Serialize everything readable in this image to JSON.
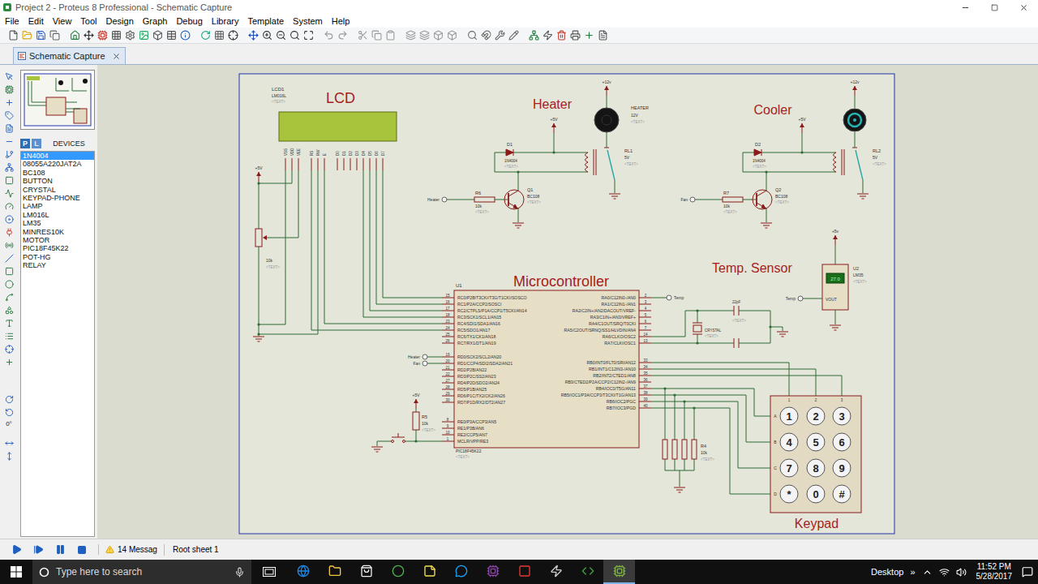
{
  "window": {
    "title": "Project 2 - Proteus 8 Professional - Schematic Capture"
  },
  "menu": [
    "File",
    "Edit",
    "View",
    "Tool",
    "Design",
    "Graph",
    "Debug",
    "Library",
    "Template",
    "System",
    "Help"
  ],
  "tabs": [
    {
      "label": "Schematic Capture",
      "selected": true
    }
  ],
  "rotation": "0°",
  "picker": {
    "modes": [
      {
        "label": "P",
        "selected": true
      },
      {
        "label": "L",
        "selected": false
      }
    ],
    "title": "DEVICES",
    "devices": [
      {
        "label": "1N4004",
        "selected": true
      },
      {
        "label": "08055A220JAT2A",
        "selected": false
      },
      {
        "label": "BC108",
        "selected": false
      },
      {
        "label": "BUTTON",
        "selected": false
      },
      {
        "label": "CRYSTAL",
        "selected": false
      },
      {
        "label": "KEYPAD-PHONE",
        "selected": false
      },
      {
        "label": "LAMP",
        "selected": false
      },
      {
        "label": "LM016L",
        "selected": false
      },
      {
        "label": "LM35",
        "selected": false
      },
      {
        "label": "MINRES10K",
        "selected": false
      },
      {
        "label": "MOTOR",
        "selected": false
      },
      {
        "label": "PIC18F45K22",
        "selected": false
      },
      {
        "label": "POT-HG",
        "selected": false
      },
      {
        "label": "RELAY",
        "selected": false
      }
    ]
  },
  "schematic": {
    "lcd": {
      "ref": "LCD1",
      "part": "LM016L",
      "text": "<TEXT>",
      "title": "LCD",
      "pins": [
        "VSS",
        "VDD",
        "VEE",
        "RS",
        "RW",
        "E",
        "D0",
        "D1",
        "D2",
        "D3",
        "D4",
        "D5",
        "D6",
        "D7"
      ]
    },
    "contrast_pot": {
      "supply": "+5V",
      "value": "10k",
      "text": "<TEXT>"
    },
    "drivers": [
      {
        "title": "Heater",
        "net": "Heater",
        "load": {
          "kind": "lamp",
          "name": "HEATER",
          "rating": "12V",
          "text": "<TEXT>",
          "supply": "+12v"
        },
        "diode": {
          "ref": "D1",
          "part": "1N4004",
          "text": "<TEXT>"
        },
        "relay": {
          "ref": "RL1",
          "rating": "5V",
          "text": "<TEXT>",
          "supply": "+5V"
        },
        "transistor": {
          "ref": "Q1",
          "part": "BC108",
          "text": "<TEXT>"
        },
        "resistor": {
          "ref": "R6",
          "value": "10k",
          "text": "<TEXT>"
        }
      },
      {
        "title": "Cooler",
        "net": "Fan",
        "load": {
          "kind": "motor",
          "supply": "+12v"
        },
        "diode": {
          "ref": "D2",
          "part": "1N4004",
          "text": "<TEXT>"
        },
        "relay": {
          "ref": "RL2",
          "rating": "5V",
          "text": "<TEXT>",
          "supply": "+5V"
        },
        "transistor": {
          "ref": "Q2",
          "part": "BC108",
          "text": "<TEXT>"
        },
        "resistor": {
          "ref": "R7",
          "value": "10k",
          "text": "<TEXT>"
        }
      }
    ],
    "mcu": {
      "title": "Microcontroller",
      "ref": "U1",
      "part": "PIC18F45K22",
      "text": "<TEXT>",
      "left_pins": [
        {
          "number": "15",
          "name": "RC0/P2B/T3CKI/T3G/T1CKI/SOSCO"
        },
        {
          "number": "16",
          "name": "RC1/P2A/CCP2/SOSCI"
        },
        {
          "number": "17",
          "name": "RC2/CTPLS/P1A/CCP1/T5CKI/AN14"
        },
        {
          "number": "18",
          "name": "RC3/SCK1/SCL1/AN15"
        },
        {
          "number": "23",
          "name": "RC4/SDI1/SDA1/AN16"
        },
        {
          "number": "24",
          "name": "RC5/SDO1/AN17"
        },
        {
          "number": "25",
          "name": "RC6/TX1/CK1/AN18"
        },
        {
          "number": "26",
          "name": "RC7/RX1/DT1/AN19"
        },
        {
          "number": "19",
          "name": "RD0/SCK2/SCL2/AN20",
          "net": "Heater"
        },
        {
          "number": "20",
          "name": "RD1/CCP4/SDI2/SDA2/AN21",
          "net": "Fan"
        },
        {
          "number": "21",
          "name": "RD2/P2B/AN22"
        },
        {
          "number": "22",
          "name": "RD3/P2C/SS2/AN23"
        },
        {
          "number": "27",
          "name": "RD4/P2D/SDO2/AN24"
        },
        {
          "number": "28",
          "name": "RD5/P1B/AN25"
        },
        {
          "number": "29",
          "name": "RD6/P1C/TX2/CK2/AN26"
        },
        {
          "number": "30",
          "name": "RD7/P1D/RX2/DT2/AN27"
        },
        {
          "number": "8",
          "name": "RE0/P3A/CCP3/AN5"
        },
        {
          "number": "9",
          "name": "RE1/P3B/AN6"
        },
        {
          "number": "10",
          "name": "RE2/CCP5/AN7"
        },
        {
          "number": "1",
          "name": "MCLR/VPP/RE3"
        }
      ],
      "right_pins": [
        {
          "number": "2",
          "name": "RA0/C12IN0-/AN0",
          "net": "Temp"
        },
        {
          "number": "3",
          "name": "RA1/C12IN1-/AN1"
        },
        {
          "number": "4",
          "name": "RA2/C2IN+/AN2/DACOUT/VREF-"
        },
        {
          "number": "5",
          "name": "RA3/C1IN+/AN3/VREF+"
        },
        {
          "number": "6",
          "name": "RA4/C1OUT/SRQ/T0CKI"
        },
        {
          "number": "7",
          "name": "RA5/C2OUT/SRNQ/SS1/HLVDIN/AN4"
        },
        {
          "number": "14",
          "name": "RA6/CLKO/OSC2"
        },
        {
          "number": "13",
          "name": "RA7/CLKI/OSC1"
        },
        {
          "number": "33",
          "name": "RB0/INT0/FLT0/SRI/AN12"
        },
        {
          "number": "34",
          "name": "RB1/INT1/C12IN3-/AN10"
        },
        {
          "number": "35",
          "name": "RB2/INT2/CTED1/AN8"
        },
        {
          "number": "36",
          "name": "RB3/CTED2/P2A/CCP2/C12IN2-/AN9"
        },
        {
          "number": "37",
          "name": "RB4/IOC0/T5G/AN11"
        },
        {
          "number": "38",
          "name": "RB5/IOC1/P3A/CCP3/T3CKI/T1G/AN13"
        },
        {
          "number": "39",
          "name": "RB6/IOC2/PGC"
        },
        {
          "number": "40",
          "name": "RB7/IOC3/PGD"
        }
      ]
    },
    "reset": {
      "ref": "R5",
      "value": "10k",
      "text": "<TEXT>",
      "supply": "+5V"
    },
    "oscillator": {
      "capacitor": "22pF",
      "capacitor_text": "<TEXT>",
      "crystal": "CRYSTAL",
      "crystal_text": "<TEXT>"
    },
    "sensor": {
      "title": "Temp. Sensor",
      "ref": "U2",
      "part": "LM35",
      "text": "<TEXT>",
      "pin": "VOUT",
      "supply": "+5v",
      "net": "Temp",
      "reading": "27.0"
    },
    "pulldowns": {
      "ref": "R4",
      "value": "10k",
      "text": "<TEXT>"
    },
    "keypad": {
      "title": "Keypad",
      "columns": [
        "1",
        "2",
        "3"
      ],
      "rows": [
        "A",
        "B",
        "C",
        "D"
      ],
      "keys": [
        "1",
        "2",
        "3",
        "4",
        "5",
        "6",
        "7",
        "8",
        "9",
        "*",
        "0",
        "#"
      ]
    }
  },
  "status_bar": {
    "messages": "14 Messag",
    "sheet": "Root sheet 1"
  },
  "taskbar": {
    "search": {
      "placeholder": "Type here to search"
    },
    "desktop": "Desktop",
    "overflow": "»",
    "time": "11:52 PM",
    "date": "5/28/2017"
  }
}
